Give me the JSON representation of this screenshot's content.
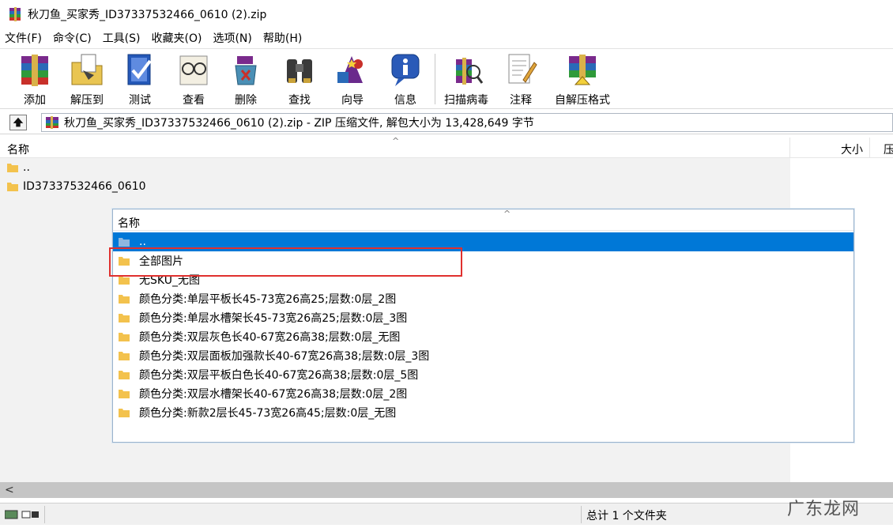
{
  "window": {
    "title": "秋刀鱼_买家秀_ID37337532466_0610 (2).zip"
  },
  "menu": [
    "文件(F)",
    "命令(C)",
    "工具(S)",
    "收藏夹(O)",
    "选项(N)",
    "帮助(H)"
  ],
  "toolbar": {
    "add": "添加",
    "extract": "解压到",
    "test": "测试",
    "view": "查看",
    "delete": "删除",
    "find": "查找",
    "wizard": "向导",
    "info": "信息",
    "scan": "扫描病毒",
    "comment": "注释",
    "sfx": "自解压格式"
  },
  "address": {
    "text": "秋刀鱼_买家秀_ID37337532466_0610 (2).zip - ZIP 压缩文件, 解包大小为 13,428,649 字节"
  },
  "columns": {
    "name": "名称",
    "size": "大小",
    "packed": "压"
  },
  "files": [
    {
      "name": ".."
    },
    {
      "name": "ID37337532466_0610"
    }
  ],
  "popup": {
    "header": "名称",
    "rows": [
      {
        "name": "..",
        "selected": true
      },
      {
        "name": "全部图片",
        "selected": false
      },
      {
        "name": "无SKU_无图",
        "selected": false
      },
      {
        "name": "颜色分类:单层平板长45-73宽26高25;层数:0层_2图",
        "selected": false
      },
      {
        "name": "颜色分类:单层水槽架长45-73宽26高25;层数:0层_3图",
        "selected": false
      },
      {
        "name": "颜色分类:双层灰色长40-67宽26高38;层数:0层_无图",
        "selected": false
      },
      {
        "name": "颜色分类:双层面板加强款长40-67宽26高38;层数:0层_3图",
        "selected": false
      },
      {
        "name": "颜色分类:双层平板白色长40-67宽26高38;层数:0层_5图",
        "selected": false
      },
      {
        "name": "颜色分类:双层水槽架长40-67宽26高38;层数:0层_2图",
        "selected": false
      },
      {
        "name": "颜色分类:新款2层长45-73宽26高45;层数:0层_无图",
        "selected": false
      }
    ]
  },
  "status": {
    "total": "总计 1 个文件夹"
  },
  "watermark": "广东龙网",
  "colors": {
    "selection": "#0078d7",
    "highlight_box": "#e0302e",
    "folder": "#f3c24d"
  }
}
